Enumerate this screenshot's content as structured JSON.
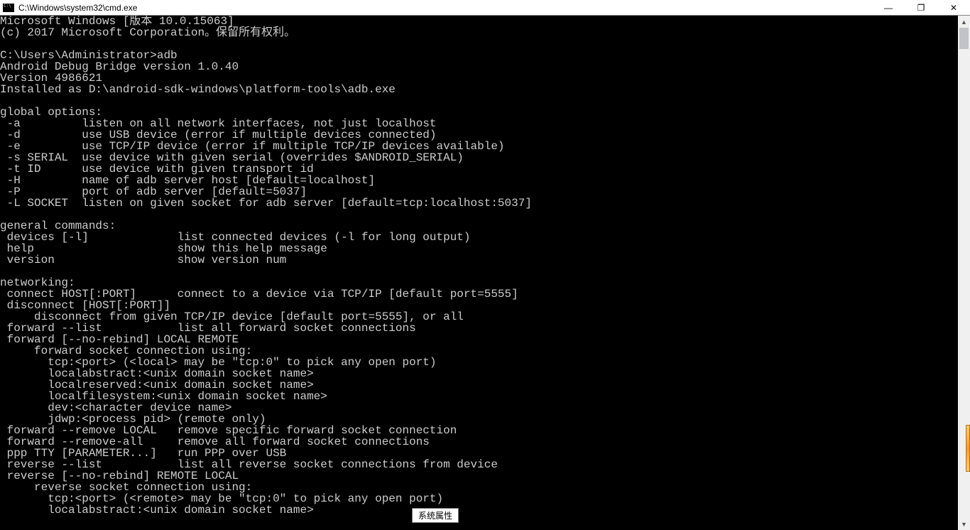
{
  "window": {
    "title": "C:\\Windows\\system32\\cmd.exe",
    "tooltip": "系统属性"
  },
  "controls": {
    "minimize": "—",
    "maximize": "❐",
    "close": "✕"
  },
  "terminal": {
    "lines": [
      "Microsoft Windows [版本 10.0.15063]",
      "(c) 2017 Microsoft Corporation。保留所有权利。",
      "",
      "C:\\Users\\Administrator>adb",
      "Android Debug Bridge version 1.0.40",
      "Version 4986621",
      "Installed as D:\\android-sdk-windows\\platform-tools\\adb.exe",
      "",
      "global options:",
      " -a         listen on all network interfaces, not just localhost",
      " -d         use USB device (error if multiple devices connected)",
      " -e         use TCP/IP device (error if multiple TCP/IP devices available)",
      " -s SERIAL  use device with given serial (overrides $ANDROID_SERIAL)",
      " -t ID      use device with given transport id",
      " -H         name of adb server host [default=localhost]",
      " -P         port of adb server [default=5037]",
      " -L SOCKET  listen on given socket for adb server [default=tcp:localhost:5037]",
      "",
      "general commands:",
      " devices [-l]             list connected devices (-l for long output)",
      " help                     show this help message",
      " version                  show version num",
      "",
      "networking:",
      " connect HOST[:PORT]      connect to a device via TCP/IP [default port=5555]",
      " disconnect [HOST[:PORT]]",
      "     disconnect from given TCP/IP device [default port=5555], or all",
      " forward --list           list all forward socket connections",
      " forward [--no-rebind] LOCAL REMOTE",
      "     forward socket connection using:",
      "       tcp:<port> (<local> may be \"tcp:0\" to pick any open port)",
      "       localabstract:<unix domain socket name>",
      "       localreserved:<unix domain socket name>",
      "       localfilesystem:<unix domain socket name>",
      "       dev:<character device name>",
      "       jdwp:<process pid> (remote only)",
      " forward --remove LOCAL   remove specific forward socket connection",
      " forward --remove-all     remove all forward socket connections",
      " ppp TTY [PARAMETER...]   run PPP over USB",
      " reverse --list           list all reverse socket connections from device",
      " reverse [--no-rebind] REMOTE LOCAL",
      "     reverse socket connection using:",
      "       tcp:<port> (<remote> may be \"tcp:0\" to pick any open port)",
      "       localabstract:<unix domain socket name>"
    ]
  }
}
